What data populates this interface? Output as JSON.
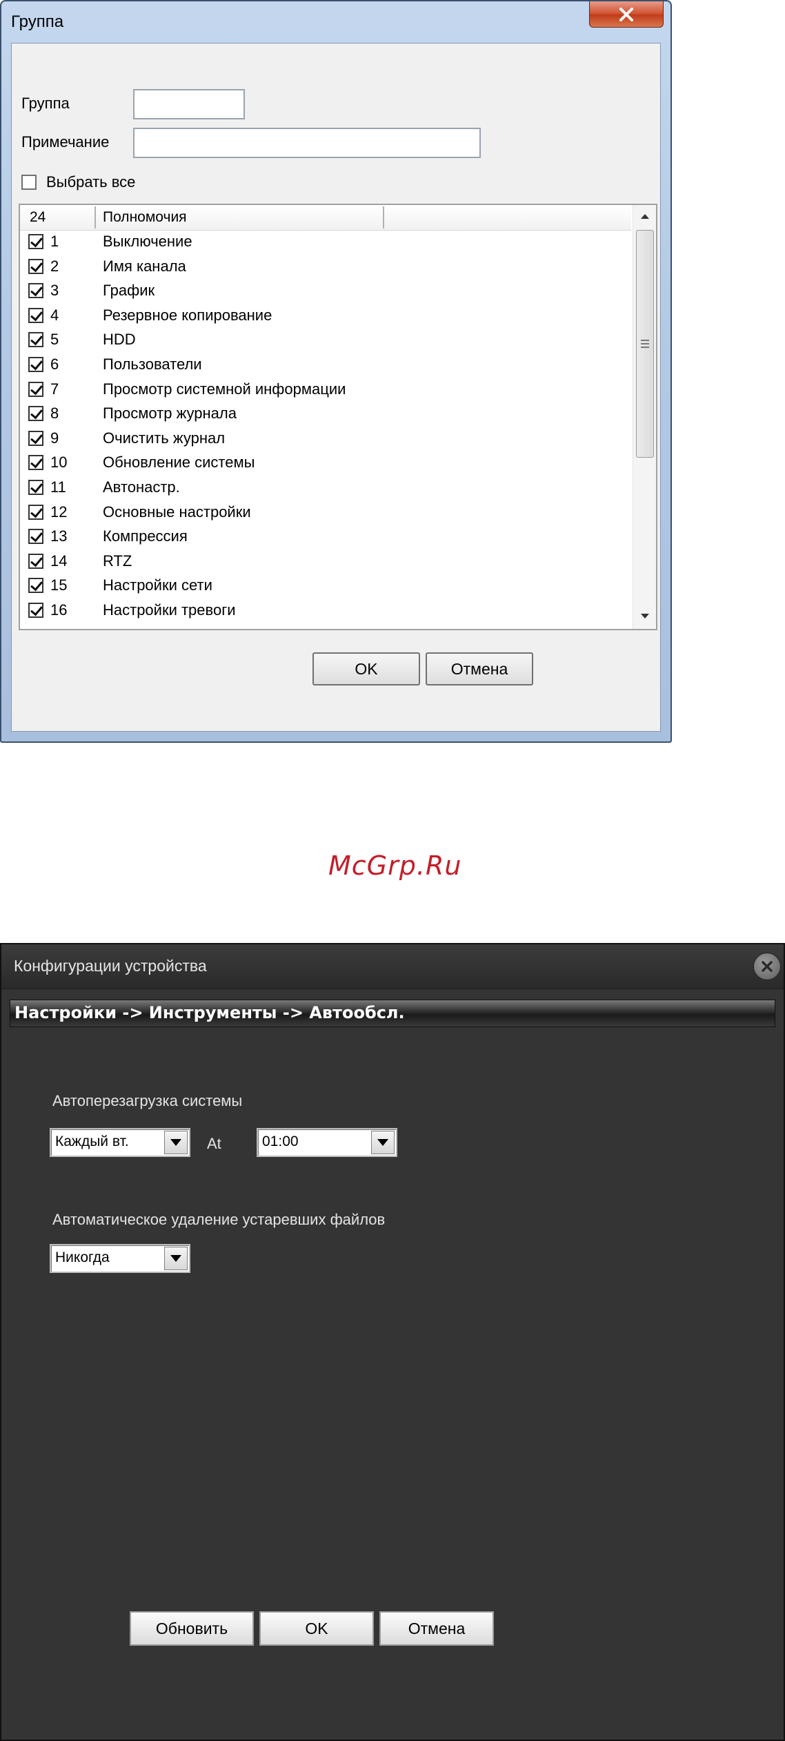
{
  "group_dialog": {
    "title": "Группа",
    "group_label": "Группа",
    "group_value": "",
    "note_label": "Примечание",
    "note_value": "",
    "select_all_label": "Выбрать все",
    "select_all_checked": false,
    "list": {
      "col_count": "24",
      "col_permissions": "Полномочия",
      "items": [
        {
          "num": "1",
          "name": "Выключение",
          "checked": true
        },
        {
          "num": "2",
          "name": "Имя канала",
          "checked": true
        },
        {
          "num": "3",
          "name": "График",
          "checked": true
        },
        {
          "num": "4",
          "name": "Резервное копирование",
          "checked": true
        },
        {
          "num": "5",
          "name": "HDD",
          "checked": true
        },
        {
          "num": "6",
          "name": "Пользователи",
          "checked": true
        },
        {
          "num": "7",
          "name": "Просмотр системной информации",
          "checked": true
        },
        {
          "num": "8",
          "name": "Просмотр журнала",
          "checked": true
        },
        {
          "num": "9",
          "name": "Очистить журнал",
          "checked": true
        },
        {
          "num": "10",
          "name": "Обновление системы",
          "checked": true
        },
        {
          "num": "11",
          "name": "Автонастр.",
          "checked": true
        },
        {
          "num": "12",
          "name": "Основные настройки",
          "checked": true
        },
        {
          "num": "13",
          "name": "Компрессия",
          "checked": true
        },
        {
          "num": "14",
          "name": "RTZ",
          "checked": true
        },
        {
          "num": "15",
          "name": "Настройки сети",
          "checked": true
        },
        {
          "num": "16",
          "name": "Настройки тревоги",
          "checked": true
        }
      ]
    },
    "ok_label": "OK",
    "cancel_label": "Отмена",
    "close_icon": "close-icon"
  },
  "watermark": "McGrp.Ru",
  "device_dialog": {
    "title": "Конфигурации устройства",
    "breadcrumb": "Настройки -> Инструменты -> Автообсл.",
    "reboot_label": "Автоперезагрузка системы",
    "reboot_day_value": "Каждый вт.",
    "at_label": "At",
    "reboot_time_value": "01:00",
    "delete_label": "Автоматическое удаление устаревших файлов",
    "delete_value": "Никогда",
    "refresh_label": "Обновить",
    "ok_label": "OK",
    "cancel_label": "Отмена"
  },
  "colors": {
    "win7_frame": "#b4cbe6",
    "close_red": "#c03a18",
    "dark_bg": "#343434",
    "watermark_red": "#c21f2a"
  }
}
